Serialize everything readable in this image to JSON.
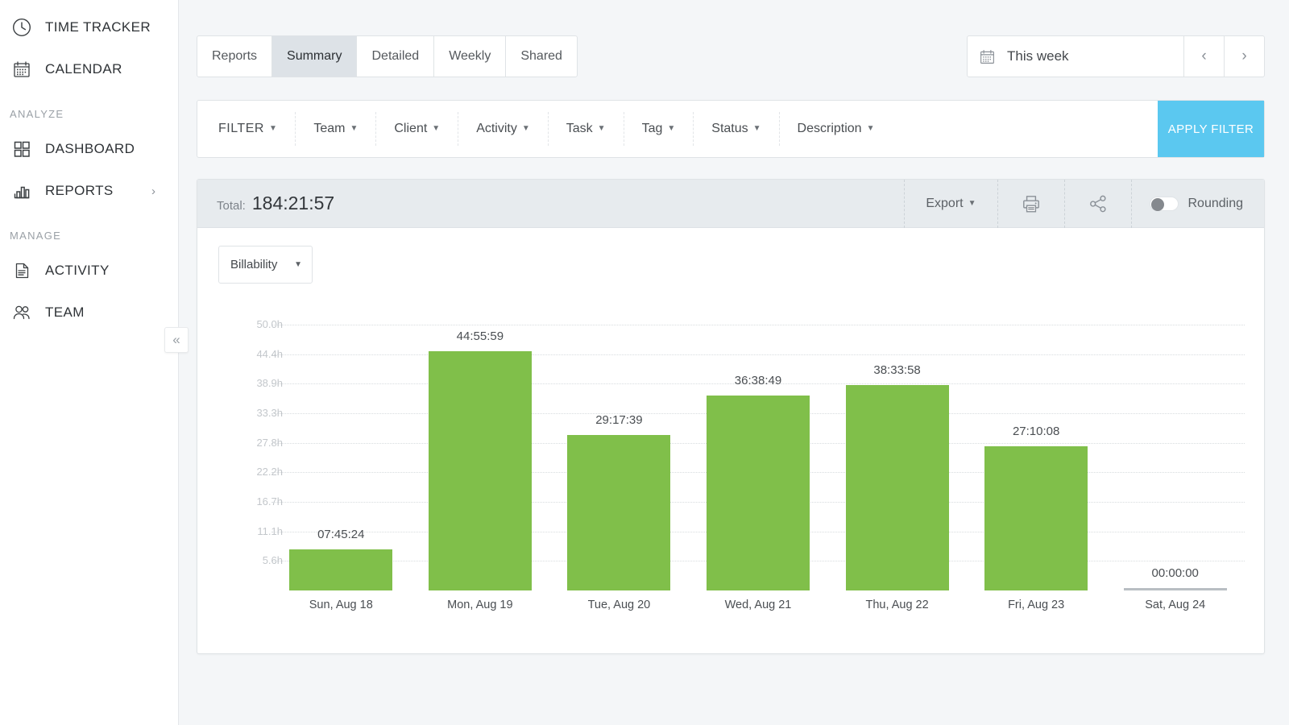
{
  "sidebar": {
    "items": [
      {
        "label": "TIME TRACKER",
        "icon": "clock-icon"
      },
      {
        "label": "CALENDAR",
        "icon": "calendar-icon"
      }
    ],
    "sections": [
      {
        "title": "ANALYZE",
        "items": [
          {
            "label": "DASHBOARD",
            "icon": "grid-icon"
          },
          {
            "label": "REPORTS",
            "icon": "bar-chart-icon",
            "arrow": "›"
          }
        ]
      },
      {
        "title": "MANAGE",
        "items": [
          {
            "label": "ACTIVITY",
            "icon": "document-icon"
          },
          {
            "label": "TEAM",
            "icon": "people-icon"
          }
        ]
      }
    ],
    "collapse_glyph": "«"
  },
  "tabs": [
    {
      "label": "Reports",
      "active": false
    },
    {
      "label": "Summary",
      "active": true
    },
    {
      "label": "Detailed",
      "active": false
    },
    {
      "label": "Weekly",
      "active": false
    },
    {
      "label": "Shared",
      "active": false
    }
  ],
  "date_range": {
    "value": "This week",
    "prev_glyph": "‹",
    "next_glyph": "›"
  },
  "filters": {
    "items": [
      "FILTER",
      "Team",
      "Client",
      "Activity",
      "Task",
      "Tag",
      "Status",
      "Description"
    ],
    "caret": "▼",
    "apply_label": "APPLY FILTER",
    "apply_color": "#5bc8f0"
  },
  "report": {
    "total_label": "Total:",
    "total_value": "184:21:57",
    "export_label": "Export",
    "rounding_label": "Rounding",
    "rounding_on": false,
    "group_by": "Billability"
  },
  "chart_data": {
    "type": "bar",
    "title": "",
    "xlabel": "",
    "ylabel": "",
    "ylim": [
      0,
      50
    ],
    "grid": true,
    "bar_color": "#80bf4a",
    "ytick_labels": [
      "50.0h",
      "44.4h",
      "38.9h",
      "33.3h",
      "27.8h",
      "22.2h",
      "16.7h",
      "11.1h",
      "5.6h"
    ],
    "ytick_values": [
      50.0,
      44.4,
      38.9,
      33.3,
      27.8,
      22.2,
      16.7,
      11.1,
      5.6
    ],
    "categories": [
      "Sun, Aug 18",
      "Mon, Aug 19",
      "Tue, Aug 20",
      "Wed, Aug 21",
      "Thu, Aug 22",
      "Fri, Aug 23",
      "Sat, Aug 24"
    ],
    "value_labels": [
      "07:45:24",
      "44:55:59",
      "29:17:39",
      "36:38:49",
      "38:33:58",
      "27:10:08",
      "00:00:00"
    ],
    "values": [
      7.7567,
      44.9331,
      29.2942,
      36.6469,
      38.5661,
      27.1689,
      0
    ]
  }
}
